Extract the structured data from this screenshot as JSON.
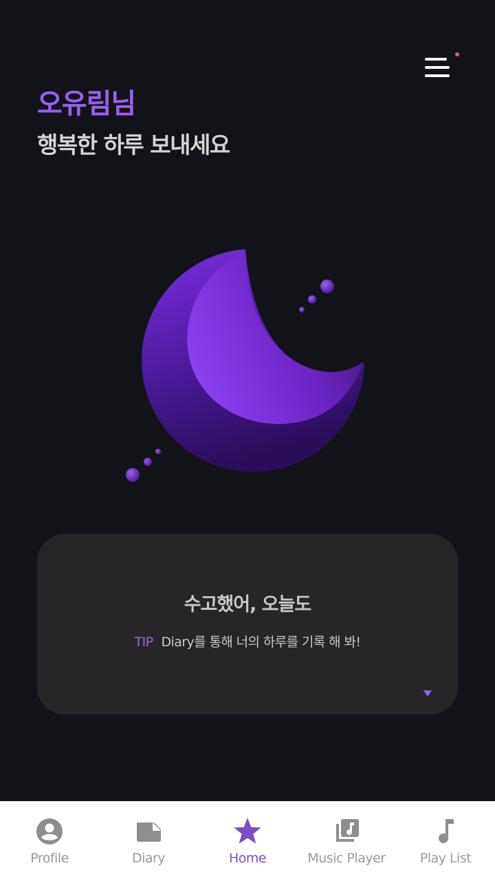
{
  "header": {
    "user_name": "오유림님",
    "subtitle": "행복한 하루 보내세요",
    "menu_icon": "menu-icon",
    "notification_dot_color": "#e05a7a"
  },
  "moon": {
    "icon": "crescent-moon-illustration",
    "colors": [
      "#7a2fe0",
      "#3a1480",
      "#9a4ff0"
    ]
  },
  "card": {
    "title": "수고했어, 오늘도",
    "tip_label": "TIP",
    "tip_text": "Diary를 통해 너의 하루를 기록 해 봐!",
    "toggle_icon": "caret-down-icon"
  },
  "tabs": [
    {
      "label": "Profile",
      "icon": "profile-icon",
      "active": false
    },
    {
      "label": "Diary",
      "icon": "diary-icon",
      "active": false
    },
    {
      "label": "Home",
      "icon": "star-icon",
      "active": true
    },
    {
      "label": "Music Player",
      "icon": "music-library-icon",
      "active": false
    },
    {
      "label": "Play List",
      "icon": "music-note-icon",
      "active": false
    }
  ],
  "colors": {
    "background": "#121318",
    "accent": "#9a5ff0",
    "card": "#262628",
    "tab_active": "#7b4fc0",
    "tab_inactive": "#9a9a9c"
  }
}
